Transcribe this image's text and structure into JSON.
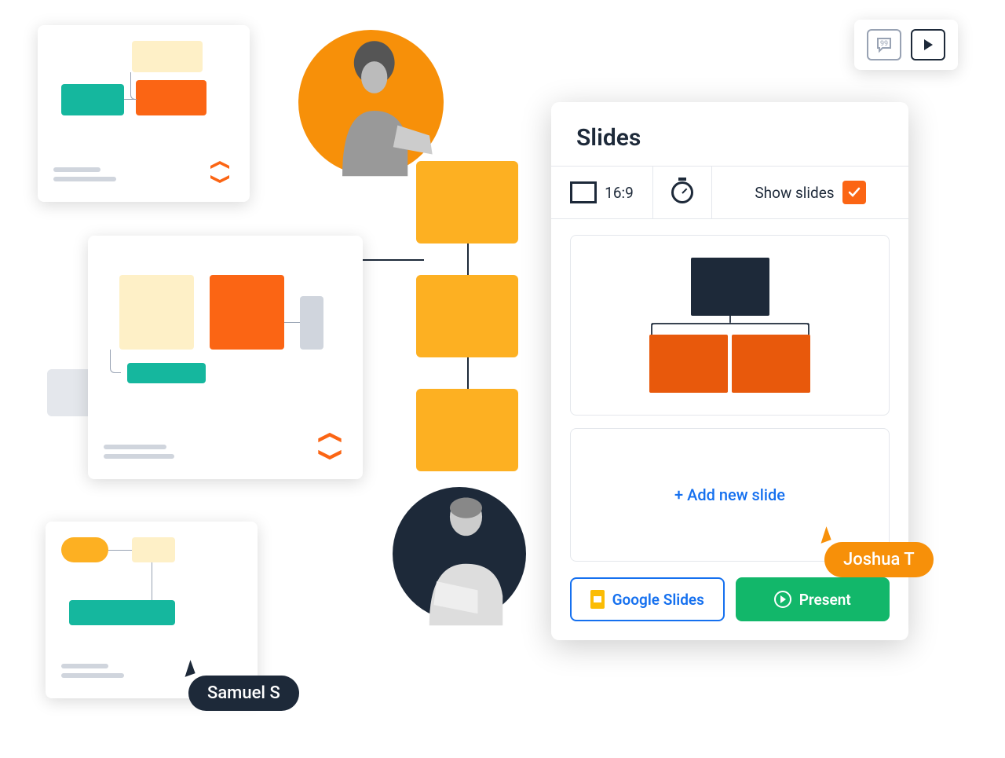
{
  "slides_panel": {
    "title": "Slides",
    "aspect_ratio": "16:9",
    "show_slides_label": "Show slides",
    "show_slides_checked": true,
    "add_new_slide": "+  Add new slide",
    "google_slides_btn": "Google Slides",
    "present_btn": "Present"
  },
  "cursors": {
    "user1": "Samuel S",
    "user2": "Joshua T"
  },
  "colors": {
    "orange": "#fb6514",
    "orange_light": "#fdb022",
    "teal": "#12b76a",
    "teal_mid": "#15b79e",
    "cream": "#fef0c7",
    "dark": "#1d2939",
    "blue": "#1570ef",
    "gray": "#d0d5dd"
  }
}
